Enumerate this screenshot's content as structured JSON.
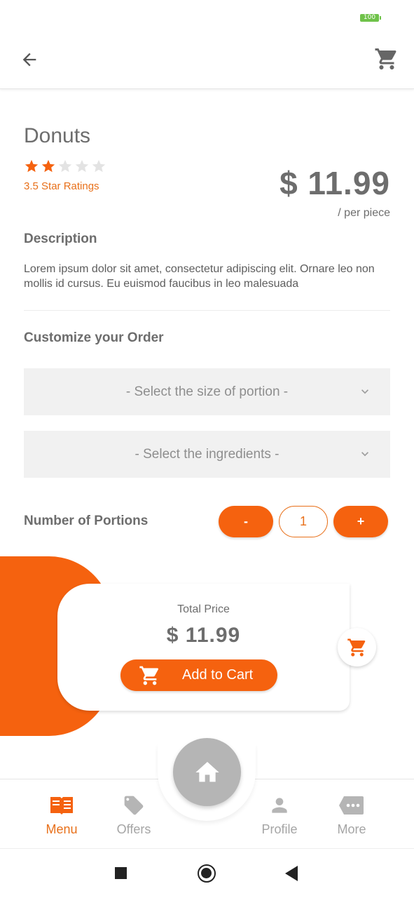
{
  "status_bar": {
    "battery": "100"
  },
  "product": {
    "name": "Donuts",
    "rating_stars": 2,
    "rating_max": 5,
    "rating_text": "3.5 Star Ratings",
    "price": "$ 11.99",
    "per_unit": "/ per piece"
  },
  "description": {
    "title": "Description",
    "text": "Lorem ipsum dolor sit amet, consectetur adipiscing elit. Ornare leo non mollis id cursus. Eu euismod faucibus in leo malesuada"
  },
  "customize": {
    "title": "Customize your Order",
    "portion_size_placeholder": "- Select the size of portion -",
    "ingredients_placeholder": "- Select the ingredients -"
  },
  "portions": {
    "label": "Number of Portions",
    "minus": "-",
    "plus": "+",
    "quantity": "1"
  },
  "total": {
    "label": "Total Price",
    "price": "$ 11.99",
    "add_to_cart": "Add to Cart"
  },
  "bottom_nav": {
    "items": [
      {
        "label": "Menu",
        "icon": "menu-book-icon",
        "active": true
      },
      {
        "label": "Offers",
        "icon": "tag-icon",
        "active": false
      },
      {
        "label": "Profile",
        "icon": "person-icon",
        "active": false
      },
      {
        "label": "More",
        "icon": "more-icon",
        "active": false
      }
    ],
    "center": {
      "icon": "home-icon"
    }
  },
  "colors": {
    "accent": "#f5620f",
    "accent_text": "#e8701a",
    "text": "#6d6d6d",
    "muted": "#a5a5a5",
    "field_bg": "#f1f1f1"
  }
}
